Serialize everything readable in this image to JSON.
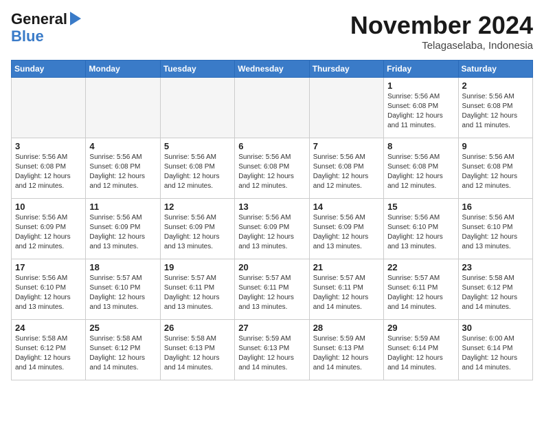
{
  "header": {
    "logo_line1": "General",
    "logo_line2": "Blue",
    "month": "November 2024",
    "location": "Telagaselaba, Indonesia"
  },
  "weekdays": [
    "Sunday",
    "Monday",
    "Tuesday",
    "Wednesday",
    "Thursday",
    "Friday",
    "Saturday"
  ],
  "weeks": [
    [
      {
        "day": "",
        "info": ""
      },
      {
        "day": "",
        "info": ""
      },
      {
        "day": "",
        "info": ""
      },
      {
        "day": "",
        "info": ""
      },
      {
        "day": "",
        "info": ""
      },
      {
        "day": "1",
        "info": "Sunrise: 5:56 AM\nSunset: 6:08 PM\nDaylight: 12 hours\nand 11 minutes."
      },
      {
        "day": "2",
        "info": "Sunrise: 5:56 AM\nSunset: 6:08 PM\nDaylight: 12 hours\nand 11 minutes."
      }
    ],
    [
      {
        "day": "3",
        "info": "Sunrise: 5:56 AM\nSunset: 6:08 PM\nDaylight: 12 hours\nand 12 minutes."
      },
      {
        "day": "4",
        "info": "Sunrise: 5:56 AM\nSunset: 6:08 PM\nDaylight: 12 hours\nand 12 minutes."
      },
      {
        "day": "5",
        "info": "Sunrise: 5:56 AM\nSunset: 6:08 PM\nDaylight: 12 hours\nand 12 minutes."
      },
      {
        "day": "6",
        "info": "Sunrise: 5:56 AM\nSunset: 6:08 PM\nDaylight: 12 hours\nand 12 minutes."
      },
      {
        "day": "7",
        "info": "Sunrise: 5:56 AM\nSunset: 6:08 PM\nDaylight: 12 hours\nand 12 minutes."
      },
      {
        "day": "8",
        "info": "Sunrise: 5:56 AM\nSunset: 6:08 PM\nDaylight: 12 hours\nand 12 minutes."
      },
      {
        "day": "9",
        "info": "Sunrise: 5:56 AM\nSunset: 6:08 PM\nDaylight: 12 hours\nand 12 minutes."
      }
    ],
    [
      {
        "day": "10",
        "info": "Sunrise: 5:56 AM\nSunset: 6:09 PM\nDaylight: 12 hours\nand 12 minutes."
      },
      {
        "day": "11",
        "info": "Sunrise: 5:56 AM\nSunset: 6:09 PM\nDaylight: 12 hours\nand 13 minutes."
      },
      {
        "day": "12",
        "info": "Sunrise: 5:56 AM\nSunset: 6:09 PM\nDaylight: 12 hours\nand 13 minutes."
      },
      {
        "day": "13",
        "info": "Sunrise: 5:56 AM\nSunset: 6:09 PM\nDaylight: 12 hours\nand 13 minutes."
      },
      {
        "day": "14",
        "info": "Sunrise: 5:56 AM\nSunset: 6:09 PM\nDaylight: 12 hours\nand 13 minutes."
      },
      {
        "day": "15",
        "info": "Sunrise: 5:56 AM\nSunset: 6:10 PM\nDaylight: 12 hours\nand 13 minutes."
      },
      {
        "day": "16",
        "info": "Sunrise: 5:56 AM\nSunset: 6:10 PM\nDaylight: 12 hours\nand 13 minutes."
      }
    ],
    [
      {
        "day": "17",
        "info": "Sunrise: 5:56 AM\nSunset: 6:10 PM\nDaylight: 12 hours\nand 13 minutes."
      },
      {
        "day": "18",
        "info": "Sunrise: 5:57 AM\nSunset: 6:10 PM\nDaylight: 12 hours\nand 13 minutes."
      },
      {
        "day": "19",
        "info": "Sunrise: 5:57 AM\nSunset: 6:11 PM\nDaylight: 12 hours\nand 13 minutes."
      },
      {
        "day": "20",
        "info": "Sunrise: 5:57 AM\nSunset: 6:11 PM\nDaylight: 12 hours\nand 13 minutes."
      },
      {
        "day": "21",
        "info": "Sunrise: 5:57 AM\nSunset: 6:11 PM\nDaylight: 12 hours\nand 14 minutes."
      },
      {
        "day": "22",
        "info": "Sunrise: 5:57 AM\nSunset: 6:11 PM\nDaylight: 12 hours\nand 14 minutes."
      },
      {
        "day": "23",
        "info": "Sunrise: 5:58 AM\nSunset: 6:12 PM\nDaylight: 12 hours\nand 14 minutes."
      }
    ],
    [
      {
        "day": "24",
        "info": "Sunrise: 5:58 AM\nSunset: 6:12 PM\nDaylight: 12 hours\nand 14 minutes."
      },
      {
        "day": "25",
        "info": "Sunrise: 5:58 AM\nSunset: 6:12 PM\nDaylight: 12 hours\nand 14 minutes."
      },
      {
        "day": "26",
        "info": "Sunrise: 5:58 AM\nSunset: 6:13 PM\nDaylight: 12 hours\nand 14 minutes."
      },
      {
        "day": "27",
        "info": "Sunrise: 5:59 AM\nSunset: 6:13 PM\nDaylight: 12 hours\nand 14 minutes."
      },
      {
        "day": "28",
        "info": "Sunrise: 5:59 AM\nSunset: 6:13 PM\nDaylight: 12 hours\nand 14 minutes."
      },
      {
        "day": "29",
        "info": "Sunrise: 5:59 AM\nSunset: 6:14 PM\nDaylight: 12 hours\nand 14 minutes."
      },
      {
        "day": "30",
        "info": "Sunrise: 6:00 AM\nSunset: 6:14 PM\nDaylight: 12 hours\nand 14 minutes."
      }
    ]
  ]
}
